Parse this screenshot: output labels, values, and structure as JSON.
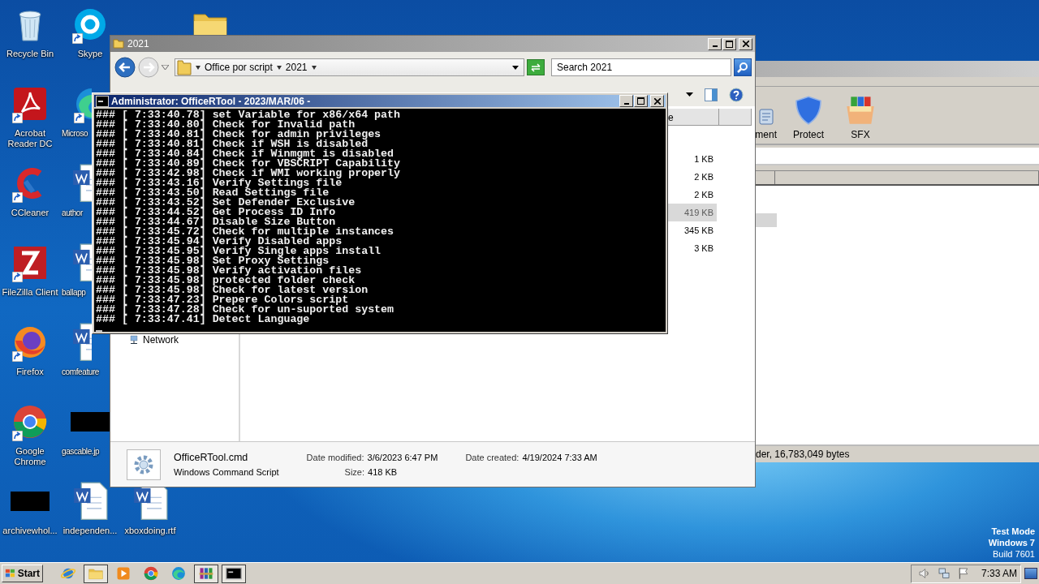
{
  "desktop_icons": [
    {
      "kind": "recycle",
      "label": "Recycle Bin",
      "shortcut": false
    },
    {
      "kind": "acrobat",
      "label": "Acrobat Reader DC",
      "shortcut": true
    },
    {
      "kind": "ccleaner",
      "label": "CCleaner",
      "shortcut": true
    },
    {
      "kind": "filezilla",
      "label": "FileZilla Client",
      "shortcut": true
    },
    {
      "kind": "firefox",
      "label": "Firefox",
      "shortcut": true
    },
    {
      "kind": "chrome",
      "label": "Google Chrome",
      "shortcut": true
    },
    {
      "kind": "blank",
      "label": "archivewhol...",
      "shortcut": false
    },
    {
      "kind": "skype",
      "label": "Skype",
      "shortcut": true
    },
    {
      "kind": "edge",
      "label": "Microso",
      "shortcut": true
    },
    {
      "kind": "word",
      "label": "author",
      "shortcut": false
    },
    {
      "kind": "word",
      "label": "ballapp",
      "shortcut": false
    },
    {
      "kind": "word",
      "label": "comfeature",
      "shortcut": false
    },
    {
      "kind": "blank",
      "label": "gascable.jp",
      "shortcut": false
    },
    {
      "kind": "word",
      "label": "independen...",
      "shortcut": false
    },
    {
      "kind": "word",
      "label": "xboxdoing.rtf",
      "shortcut": false
    },
    {
      "kind": "folder",
      "shortcut": false
    }
  ],
  "archiver": {
    "toolbar": [
      {
        "kind": "comment",
        "label": "ment"
      },
      {
        "kind": "protect",
        "label": "Protect"
      },
      {
        "kind": "sfx",
        "label": "SFX"
      }
    ],
    "rows": [
      {
        "selected": false
      },
      {
        "selected": true
      }
    ],
    "status": "der, 16,783,049 bytes"
  },
  "explorer": {
    "title": "2021",
    "breadcrumb": [
      "Office por script",
      "2021"
    ],
    "search": {
      "placeholder": "Search 2021"
    },
    "column_header": "e",
    "files": [
      {
        "size": "1 KB",
        "selected": false
      },
      {
        "size": "2 KB",
        "selected": false
      },
      {
        "size": "2 KB",
        "selected": false
      },
      {
        "size": "419 KB",
        "selected": true
      },
      {
        "size": "345 KB",
        "selected": false
      },
      {
        "size": "3 KB",
        "selected": false
      }
    ],
    "nav_item": "Network",
    "details": {
      "name": "OfficeRTool.cmd",
      "type": "Windows Command Script",
      "properties": [
        {
          "label": "Date modified:",
          "value": "3/6/2023 6:47 PM"
        },
        {
          "label": "Date created:",
          "value": "4/19/2024 7:33 AM"
        },
        {
          "label": "Size:",
          "value": "418 KB"
        }
      ]
    }
  },
  "console": {
    "title": "Administrator: OfficeRTool - 2023/MAR/06 -",
    "lines": [
      "### [ 7:33:40.78] set Variable for x86/x64 path",
      "### [ 7:33:40.80] Check for Invalid path",
      "### [ 7:33:40.81] Check for admin privileges",
      "### [ 7:33:40.81] Check if WSH is disabled",
      "### [ 7:33:40.84] Check if Winmgmt is disabled",
      "### [ 7:33:40.89] Check for VBSCRIPT Capability",
      "### [ 7:33:42.98] Check if WMI working properly",
      "### [ 7:33:43.16] Verify Settings file",
      "### [ 7:33:43.50] Read Settings file",
      "### [ 7:33:43.52] Set Defender Exclusive",
      "### [ 7:33:44.52] Get Process ID Info",
      "### [ 7:33:44.67] Disable Size Button",
      "### [ 7:33:45.72] Check for multiple instances",
      "### [ 7:33:45.94] Verify Disabled apps",
      "### [ 7:33:45.95] Verify Single apps install",
      "### [ 7:33:45.98] Set Proxy Settings",
      "### [ 7:33:45.98] Verify activation files",
      "### [ 7:33:45.98] protected folder check",
      "### [ 7:33:45.98] Check for latest version",
      "### [ 7:33:47.23] Prepere Colors script",
      "### [ 7:33:47.28] Check for un-suported system",
      "### [ 7:33:47.41] Detect Language"
    ]
  },
  "os_notice": [
    "Test Mode",
    "Windows 7",
    "Build 7601"
  ],
  "taskbar": {
    "start": "Start",
    "apps": [
      {
        "kind": "ie",
        "running": false
      },
      {
        "kind": "folder",
        "running": true
      },
      {
        "kind": "media",
        "running": false
      },
      {
        "kind": "chrome",
        "running": false
      },
      {
        "kind": "edge",
        "running": false
      },
      {
        "kind": "winrar",
        "running": true
      },
      {
        "kind": "cmd",
        "running": true
      }
    ],
    "tray": [
      {
        "kind": "speaker"
      },
      {
        "kind": "network"
      },
      {
        "kind": "flag"
      }
    ],
    "clock": "7:33 AM"
  }
}
